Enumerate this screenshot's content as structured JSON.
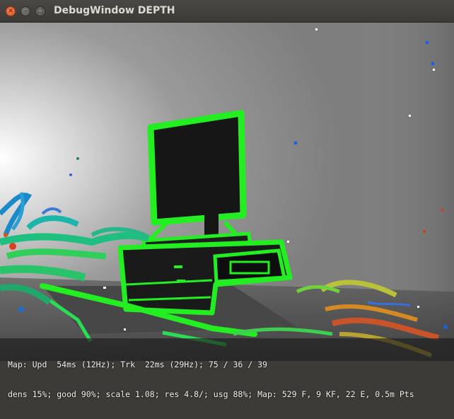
{
  "window": {
    "title": "DebugWindow DEPTH",
    "close_glyph": "✕",
    "minimize_glyph": "–",
    "maximize_glyph": "□"
  },
  "colors": {
    "edge_highlight": "#22ee22",
    "background_gray": "#8c8c8c"
  },
  "status": {
    "line1": "Map: Upd  54ms (12Hz); Trk  22ms (29Hz); 75 / 36 / 39",
    "line2": "dens 15%; good 90%; scale 1.08; res 4.8/; usg 88%; Map: 529 F, 9 KF, 22 E, 0.5m Pts"
  }
}
